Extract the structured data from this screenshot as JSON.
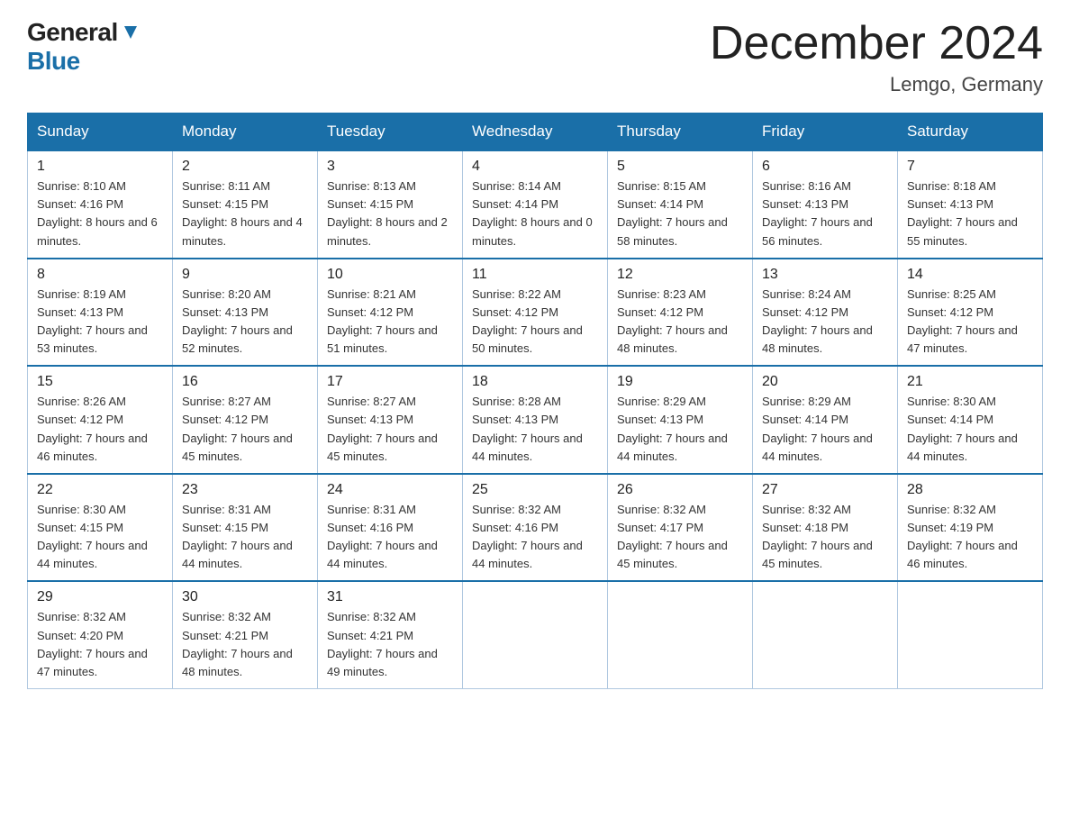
{
  "header": {
    "logo_general": "General",
    "logo_blue": "Blue",
    "month_title": "December 2024",
    "location": "Lemgo, Germany"
  },
  "weekdays": [
    "Sunday",
    "Monday",
    "Tuesday",
    "Wednesday",
    "Thursday",
    "Friday",
    "Saturday"
  ],
  "weeks": [
    [
      {
        "day": "1",
        "sunrise": "8:10 AM",
        "sunset": "4:16 PM",
        "daylight": "8 hours and 6 minutes."
      },
      {
        "day": "2",
        "sunrise": "8:11 AM",
        "sunset": "4:15 PM",
        "daylight": "8 hours and 4 minutes."
      },
      {
        "day": "3",
        "sunrise": "8:13 AM",
        "sunset": "4:15 PM",
        "daylight": "8 hours and 2 minutes."
      },
      {
        "day": "4",
        "sunrise": "8:14 AM",
        "sunset": "4:14 PM",
        "daylight": "8 hours and 0 minutes."
      },
      {
        "day": "5",
        "sunrise": "8:15 AM",
        "sunset": "4:14 PM",
        "daylight": "7 hours and 58 minutes."
      },
      {
        "day": "6",
        "sunrise": "8:16 AM",
        "sunset": "4:13 PM",
        "daylight": "7 hours and 56 minutes."
      },
      {
        "day": "7",
        "sunrise": "8:18 AM",
        "sunset": "4:13 PM",
        "daylight": "7 hours and 55 minutes."
      }
    ],
    [
      {
        "day": "8",
        "sunrise": "8:19 AM",
        "sunset": "4:13 PM",
        "daylight": "7 hours and 53 minutes."
      },
      {
        "day": "9",
        "sunrise": "8:20 AM",
        "sunset": "4:13 PM",
        "daylight": "7 hours and 52 minutes."
      },
      {
        "day": "10",
        "sunrise": "8:21 AM",
        "sunset": "4:12 PM",
        "daylight": "7 hours and 51 minutes."
      },
      {
        "day": "11",
        "sunrise": "8:22 AM",
        "sunset": "4:12 PM",
        "daylight": "7 hours and 50 minutes."
      },
      {
        "day": "12",
        "sunrise": "8:23 AM",
        "sunset": "4:12 PM",
        "daylight": "7 hours and 48 minutes."
      },
      {
        "day": "13",
        "sunrise": "8:24 AM",
        "sunset": "4:12 PM",
        "daylight": "7 hours and 48 minutes."
      },
      {
        "day": "14",
        "sunrise": "8:25 AM",
        "sunset": "4:12 PM",
        "daylight": "7 hours and 47 minutes."
      }
    ],
    [
      {
        "day": "15",
        "sunrise": "8:26 AM",
        "sunset": "4:12 PM",
        "daylight": "7 hours and 46 minutes."
      },
      {
        "day": "16",
        "sunrise": "8:27 AM",
        "sunset": "4:12 PM",
        "daylight": "7 hours and 45 minutes."
      },
      {
        "day": "17",
        "sunrise": "8:27 AM",
        "sunset": "4:13 PM",
        "daylight": "7 hours and 45 minutes."
      },
      {
        "day": "18",
        "sunrise": "8:28 AM",
        "sunset": "4:13 PM",
        "daylight": "7 hours and 44 minutes."
      },
      {
        "day": "19",
        "sunrise": "8:29 AM",
        "sunset": "4:13 PM",
        "daylight": "7 hours and 44 minutes."
      },
      {
        "day": "20",
        "sunrise": "8:29 AM",
        "sunset": "4:14 PM",
        "daylight": "7 hours and 44 minutes."
      },
      {
        "day": "21",
        "sunrise": "8:30 AM",
        "sunset": "4:14 PM",
        "daylight": "7 hours and 44 minutes."
      }
    ],
    [
      {
        "day": "22",
        "sunrise": "8:30 AM",
        "sunset": "4:15 PM",
        "daylight": "7 hours and 44 minutes."
      },
      {
        "day": "23",
        "sunrise": "8:31 AM",
        "sunset": "4:15 PM",
        "daylight": "7 hours and 44 minutes."
      },
      {
        "day": "24",
        "sunrise": "8:31 AM",
        "sunset": "4:16 PM",
        "daylight": "7 hours and 44 minutes."
      },
      {
        "day": "25",
        "sunrise": "8:32 AM",
        "sunset": "4:16 PM",
        "daylight": "7 hours and 44 minutes."
      },
      {
        "day": "26",
        "sunrise": "8:32 AM",
        "sunset": "4:17 PM",
        "daylight": "7 hours and 45 minutes."
      },
      {
        "day": "27",
        "sunrise": "8:32 AM",
        "sunset": "4:18 PM",
        "daylight": "7 hours and 45 minutes."
      },
      {
        "day": "28",
        "sunrise": "8:32 AM",
        "sunset": "4:19 PM",
        "daylight": "7 hours and 46 minutes."
      }
    ],
    [
      {
        "day": "29",
        "sunrise": "8:32 AM",
        "sunset": "4:20 PM",
        "daylight": "7 hours and 47 minutes."
      },
      {
        "day": "30",
        "sunrise": "8:32 AM",
        "sunset": "4:21 PM",
        "daylight": "7 hours and 48 minutes."
      },
      {
        "day": "31",
        "sunrise": "8:32 AM",
        "sunset": "4:21 PM",
        "daylight": "7 hours and 49 minutes."
      },
      null,
      null,
      null,
      null
    ]
  ],
  "labels": {
    "sunrise_prefix": "Sunrise: ",
    "sunset_prefix": "Sunset: ",
    "daylight_prefix": "Daylight: "
  }
}
